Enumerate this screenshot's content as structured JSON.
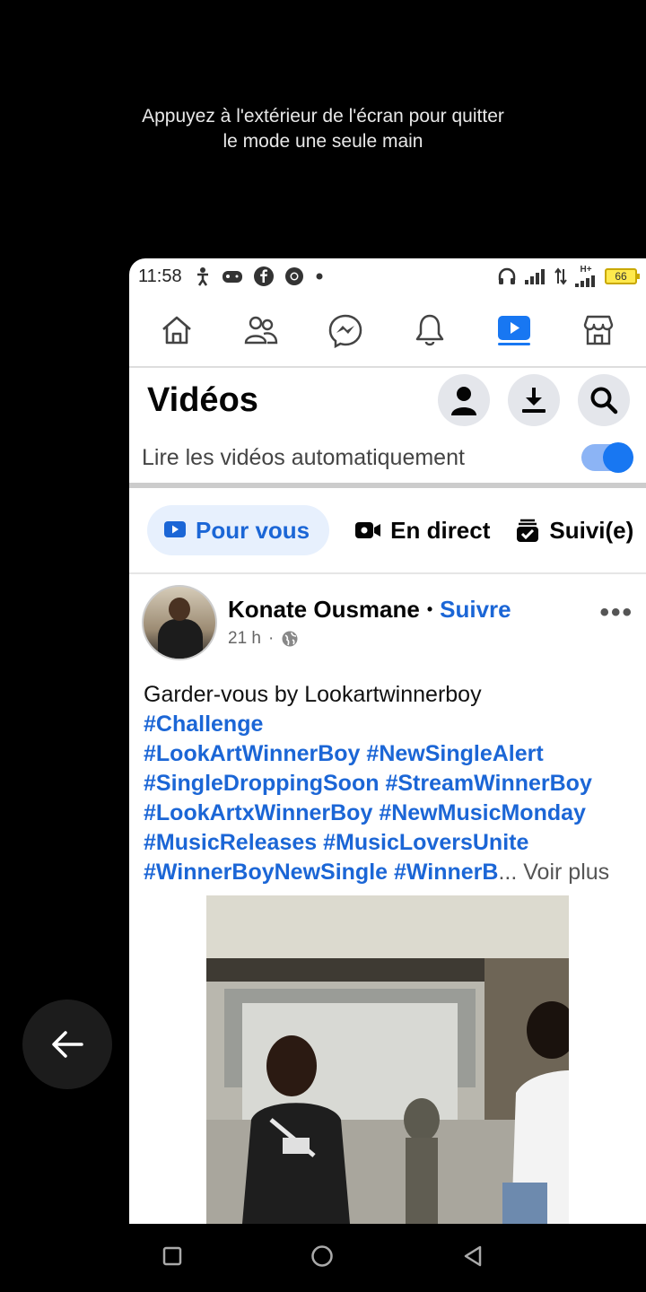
{
  "one_hand_mode": {
    "hint_line1": "Appuyez à l'extérieur de l'écran pour quitter",
    "hint_line2": "le mode une seule main"
  },
  "status_bar": {
    "time": "11:58",
    "network_label": "H+",
    "battery": "66"
  },
  "top_nav": {
    "items": [
      {
        "icon": "home-icon"
      },
      {
        "icon": "friends-icon"
      },
      {
        "icon": "messenger-icon"
      },
      {
        "icon": "notifications-icon"
      },
      {
        "icon": "video-icon",
        "active": true
      },
      {
        "icon": "marketplace-icon"
      }
    ],
    "accent": "#1877f2"
  },
  "header": {
    "title": "Vidéos",
    "actions": [
      "profile-icon",
      "download-icon",
      "search-icon"
    ]
  },
  "autoplay": {
    "label": "Lire les vidéos automatiquement",
    "enabled": true
  },
  "tabs": [
    {
      "label": "Pour vous",
      "icon": "play-icon",
      "active": true
    },
    {
      "label": "En direct",
      "icon": "live-camera-icon",
      "active": false
    },
    {
      "label": "Suivi(e)",
      "icon": "following-icon",
      "active": false
    }
  ],
  "post": {
    "author": "Konate Ousmane",
    "follow": "Suivre",
    "time": "21 h",
    "caption_text": "Garder-vous by Lookartwinnerboy",
    "hashtags": [
      "#Challenge",
      "#LookArtWinnerBoy",
      "#NewSingleAlert",
      "#SingleDroppingSoon",
      "#StreamWinnerBoy",
      "#LookArtxWinnerBoy",
      "#NewMusicMonday",
      "#MusicReleases",
      "#MusicLoversUnite",
      "#WinnerBoyNewSingle",
      "#WinnerB"
    ],
    "ellipsis": "...",
    "see_more": "Voir plus"
  }
}
